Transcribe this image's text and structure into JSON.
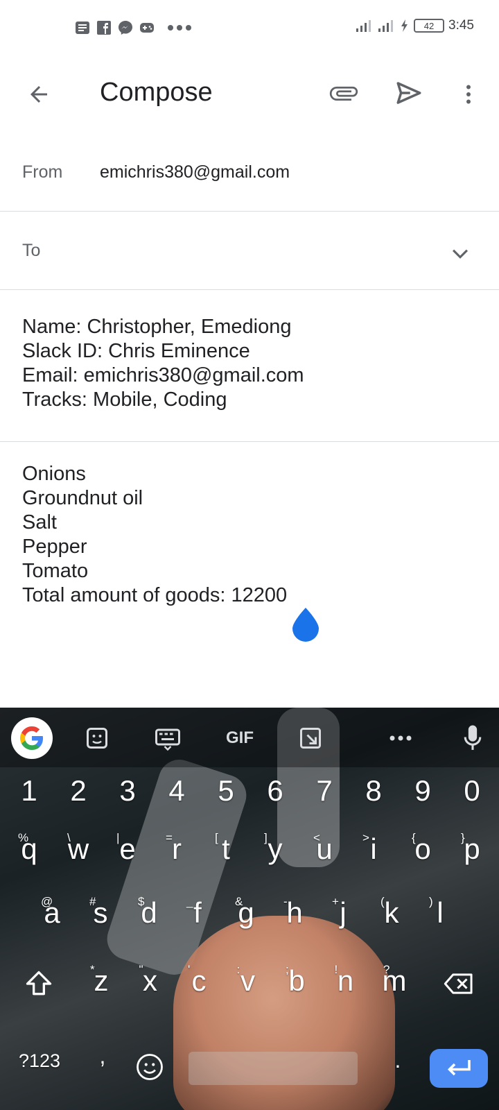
{
  "status_bar": {
    "time": "3:45",
    "battery": "42",
    "notification_icons": [
      "news-icon",
      "facebook-icon",
      "messenger-icon",
      "game-icon",
      "more-dots-icon"
    ]
  },
  "appbar": {
    "title": "Compose",
    "icons": [
      "back-arrow-icon",
      "attach-icon",
      "send-icon",
      "overflow-menu-icon"
    ]
  },
  "from": {
    "label": "From",
    "value": "emichris380@gmail.com"
  },
  "to": {
    "label": "To",
    "value": ""
  },
  "subject_lines": [
    "Name: Christopher, Emediong",
    "Slack ID: Chris Eminence",
    "Email: emichris380@gmail.com",
    "Tracks: Mobile, Coding"
  ],
  "body_lines": [
    "Onions",
    "Groundnut oil",
    "Salt",
    "Pepper",
    "Tomato",
    "Total amount of goods: 12200"
  ],
  "keyboard": {
    "toolbar_icons": [
      "google-icon",
      "sticker-icon",
      "keyboard-icon",
      "gif-icon",
      "crop-icon",
      "more-dots-icon",
      "mic-icon"
    ],
    "gif_label": "GIF",
    "numbers": [
      "1",
      "2",
      "3",
      "4",
      "5",
      "6",
      "7",
      "8",
      "9",
      "0"
    ],
    "row1": [
      "q",
      "w",
      "e",
      "r",
      "t",
      "y",
      "u",
      "i",
      "o",
      "p"
    ],
    "row1_hints": [
      "%",
      "\\",
      "|",
      "=",
      "[",
      "]",
      "<",
      ">",
      "{",
      "}"
    ],
    "row2": [
      "a",
      "s",
      "d",
      "f",
      "g",
      "h",
      "j",
      "k",
      "l"
    ],
    "row2_hints": [
      "@",
      "#",
      "$",
      "_",
      "&",
      "-",
      "+",
      "(",
      ")"
    ],
    "row3": [
      "z",
      "x",
      "c",
      "v",
      "b",
      "n",
      "m"
    ],
    "row3_hints": [
      "*",
      "\"",
      "'",
      ":",
      ";",
      "!",
      "?"
    ],
    "symbols_key": "?123",
    "comma_key": ",",
    "period_key": ".",
    "accent_color": "#4e8cf5"
  }
}
